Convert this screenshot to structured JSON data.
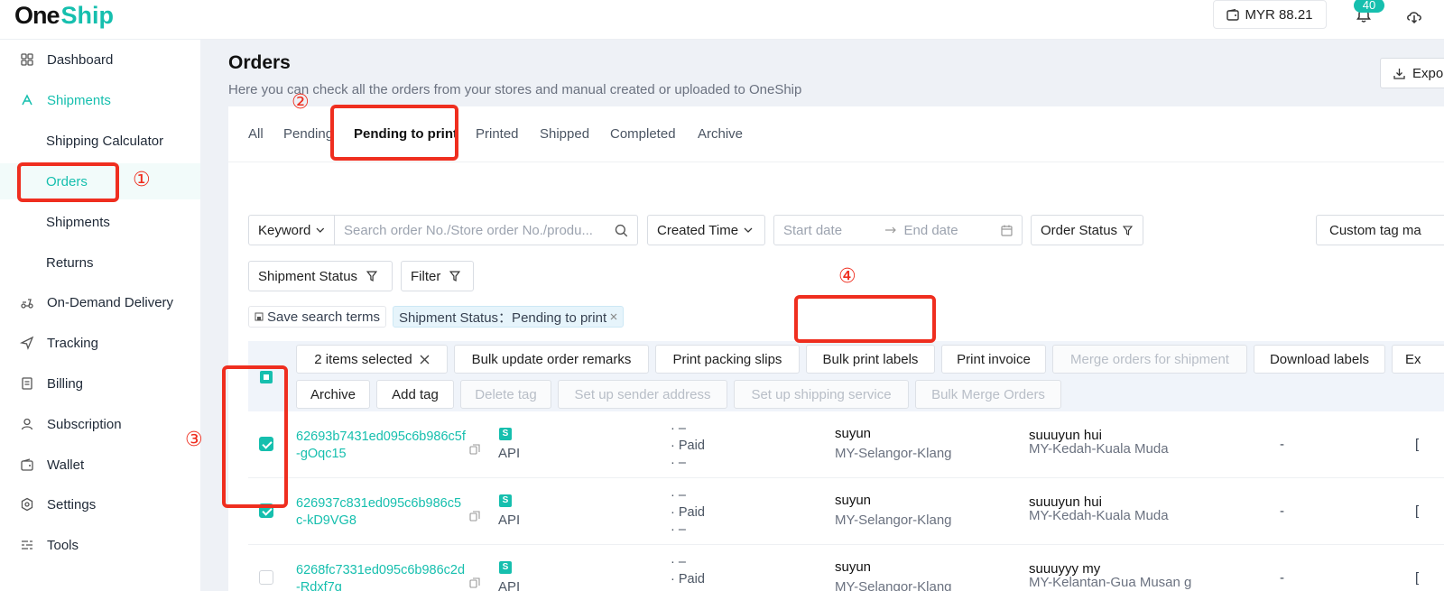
{
  "brand": {
    "part1": "One",
    "part2": "Ship"
  },
  "header": {
    "wallet_balance": "MYR 88.21",
    "notification_count": "40"
  },
  "sidebar": {
    "items": [
      {
        "label": "Dashboard",
        "icon": "dashboard-icon"
      },
      {
        "label": "Shipments",
        "icon": "shipments-icon"
      },
      {
        "label": "Shipping Calculator"
      },
      {
        "label": "Orders"
      },
      {
        "label": "Shipments"
      },
      {
        "label": "Returns"
      },
      {
        "label": "On-Demand Delivery",
        "icon": "scooter-icon"
      },
      {
        "label": "Tracking",
        "icon": "send-icon"
      },
      {
        "label": "Billing",
        "icon": "billing-icon"
      },
      {
        "label": "Subscription",
        "icon": "user-icon"
      },
      {
        "label": "Wallet",
        "icon": "wallet-icon"
      },
      {
        "label": "Settings",
        "icon": "gear-icon"
      },
      {
        "label": "Tools",
        "icon": "tools-icon"
      }
    ]
  },
  "page": {
    "title": "Orders",
    "subtitle": "Here you can check all the orders from your stores and manual created or uploaded to OneShip",
    "export_label": "Expo"
  },
  "tabs": [
    "All",
    "Pending",
    "Pending to print",
    "Printed",
    "Shipped",
    "Completed",
    "Archive"
  ],
  "filters": {
    "keyword_label": "Keyword",
    "search_placeholder": "Search order No./Store order No./produ...",
    "created_time_label": "Created Time",
    "start_date_placeholder": "Start date",
    "end_date_placeholder": "End date",
    "order_status_label": "Order Status",
    "custom_tag_label": "Custom tag ma",
    "shipment_status_label": "Shipment Status",
    "filter_label": "Filter",
    "save_search_label": "Save search terms",
    "active_filter_label": "Shipment Status：Pending to print"
  },
  "bulk": {
    "selected_label": "2 items selected",
    "buttons": [
      "Bulk update order remarks",
      "Print packing slips",
      "Bulk print labels",
      "Print invoice",
      "Merge orders for shipment",
      "Download labels",
      "Ex"
    ],
    "buttons2": [
      "Archive",
      "Add tag",
      "Delete tag",
      "Set up sender address",
      "Set up shipping service",
      "Bulk Merge Orders"
    ]
  },
  "orders": [
    {
      "id": "62693b7431ed095c6b986c5f-gOqc15",
      "store_badge": "S",
      "source": "API",
      "pay_line1": "· –",
      "pay_line2": "· Paid",
      "pay_line3": "· –",
      "sender": "suyun",
      "sender_loc": "MY-Selangor-Klang",
      "receiver": "suuuyun hui",
      "receiver_loc": "MY-Kedah-Kuala Muda",
      "col_a": "-",
      "col_b": "["
    },
    {
      "id": "626937c831ed095c6b986c5c-kD9VG8",
      "store_badge": "S",
      "source": "API",
      "pay_line1": "· –",
      "pay_line2": "· Paid",
      "pay_line3": "· –",
      "sender": "suyun",
      "sender_loc": "MY-Selangor-Klang",
      "receiver": "suuuyun hui",
      "receiver_loc": "MY-Kedah-Kuala Muda",
      "col_a": "-",
      "col_b": "["
    },
    {
      "id": "6268fc7331ed095c6b986c2d-Rdxf7g",
      "store_badge": "S",
      "source": "API",
      "pay_line1": "· –",
      "pay_line2": "· Paid",
      "pay_line3": "· –",
      "sender": "suyun",
      "sender_loc": "MY-Selangor-Klang",
      "receiver": "suuuyyy my",
      "receiver_loc": "MY-Kelantan-Gua Musan g",
      "col_a": "-",
      "col_b": "["
    }
  ],
  "annotations": [
    "①",
    "②",
    "③",
    "④"
  ],
  "colors": {
    "accent": "#16bfae",
    "highlight": "#ef2e1f"
  }
}
